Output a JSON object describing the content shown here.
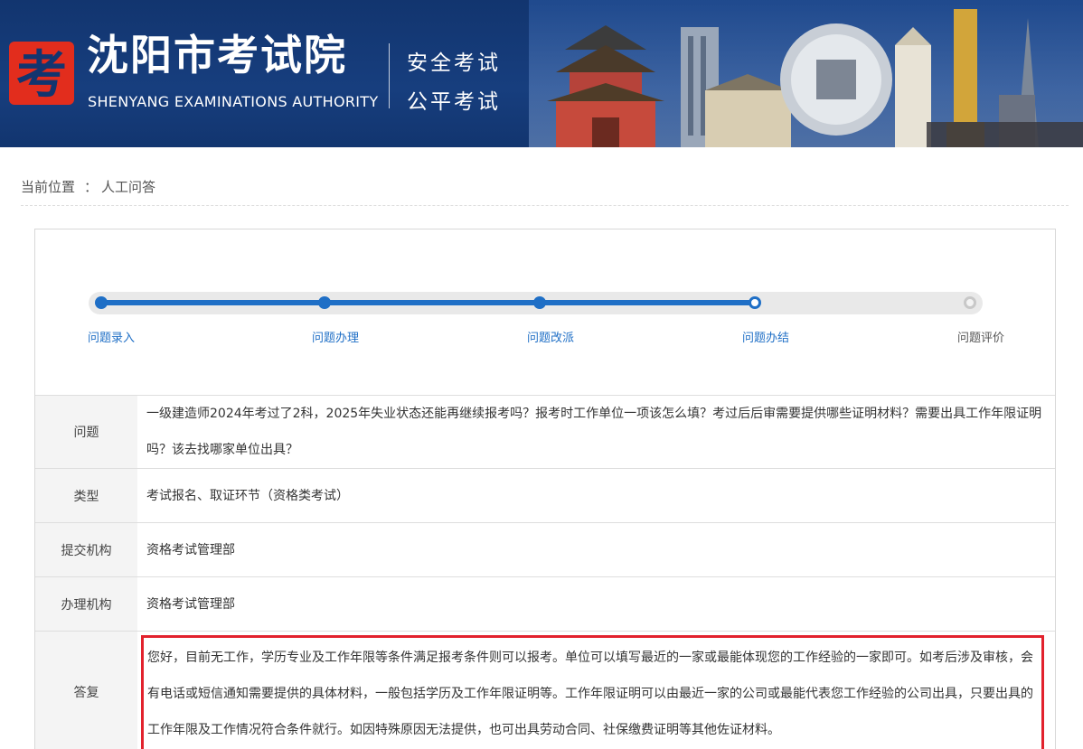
{
  "header": {
    "logo_glyph": "考",
    "title": "沈阳市考试院",
    "subtitle": "SHENYANG EXAMINATIONS AUTHORITY",
    "slogan_1": "安全考试",
    "slogan_2": "公平考试",
    "colors": {
      "background": "#173e7e",
      "logo_red": "#e22d1d",
      "text": "#ffffff"
    }
  },
  "breadcrumb": {
    "prefix": "当前位置",
    "separator": "：",
    "current": "人工问答"
  },
  "progress": {
    "accent_color": "#1f6fc6",
    "current_step_index": 3,
    "steps": [
      {
        "label": "问题录入",
        "state": "done"
      },
      {
        "label": "问题办理",
        "state": "done"
      },
      {
        "label": "问题改派",
        "state": "done"
      },
      {
        "label": "问题办结",
        "state": "current"
      },
      {
        "label": "问题评价",
        "state": "todo"
      }
    ]
  },
  "details": {
    "question_label": "问题",
    "question": "一级建造师2024年考过了2科，2025年失业状态还能再继续报考吗？报考时工作单位一项该怎么填？考过后后审需要提供哪些证明材料？需要出具工作年限证明吗？该去找哪家单位出具？",
    "type_label": "类型",
    "type": "考试报名、取证环节（资格类考试）",
    "submit_org_label": "提交机构",
    "submit_org": "资格考试管理部",
    "handle_org_label": "办理机构",
    "handle_org": "资格考试管理部",
    "answer_label": "答复",
    "answer": "您好，目前无工作，学历专业及工作年限等条件满足报考条件则可以报考。单位可以填写最近的一家或最能体现您的工作经验的一家即可。如考后涉及审核，会有电话或短信通知需要提供的具体材料，一般包括学历及工作年限证明等。工作年限证明可以由最近一家的公司或最能代表您工作经验的公司出具，只要出具的工作年限及工作情况符合条件就行。如因特殊原因无法提供，也可出具劳动合同、社保缴费证明等其他佐证材料。",
    "answer_highlight_color": "#e2222d"
  }
}
